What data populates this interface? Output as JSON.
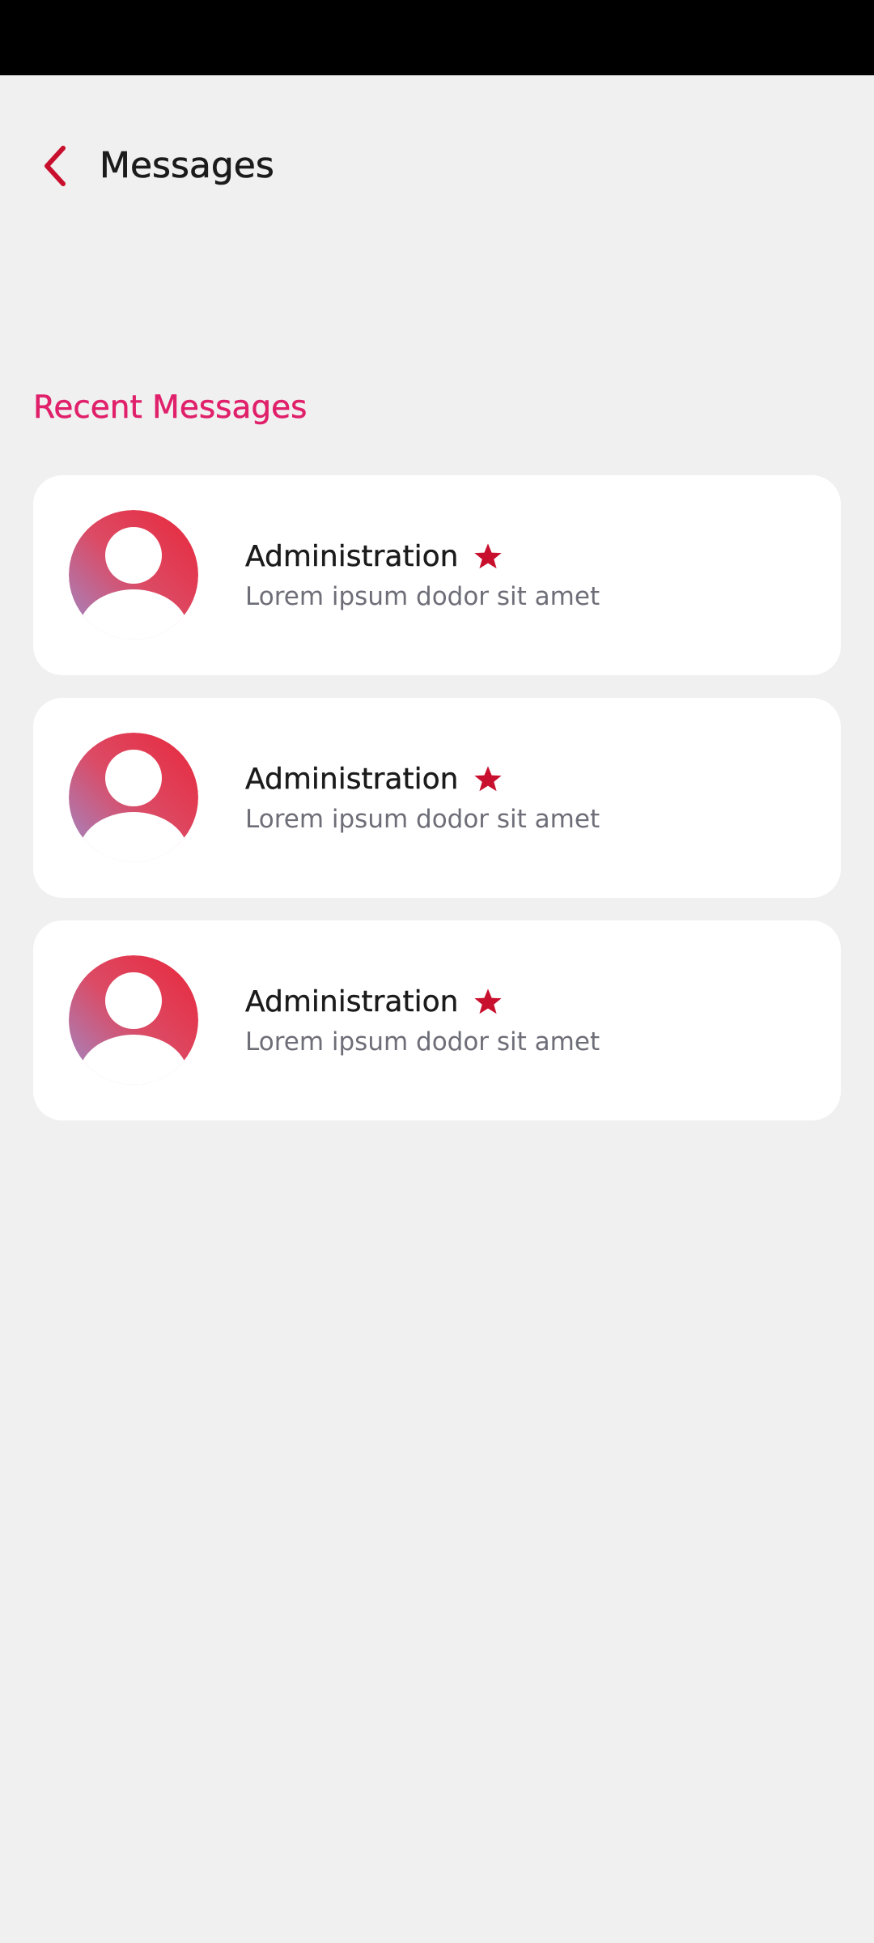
{
  "header": {
    "back_icon": "chevron-left-icon",
    "title": "Messages"
  },
  "recent": {
    "section_title": "Recent Messages",
    "items": [
      {
        "sender": "Administration",
        "preview": "Lorem ipsum dodor sit amet",
        "avatar_icon": "user-avatar-icon",
        "badge_icon": "star-icon"
      },
      {
        "sender": "Administration",
        "preview": "Lorem ipsum dodor sit amet",
        "avatar_icon": "user-avatar-icon",
        "badge_icon": "star-icon"
      },
      {
        "sender": "Administration",
        "preview": "Lorem ipsum dodor sit amet",
        "avatar_icon": "user-avatar-icon",
        "badge_icon": "star-icon"
      }
    ]
  },
  "colors": {
    "accent_red": "#c8102e",
    "section_title_pink": "#e0206a",
    "background": "#f0f0f0",
    "card": "#ffffff"
  }
}
